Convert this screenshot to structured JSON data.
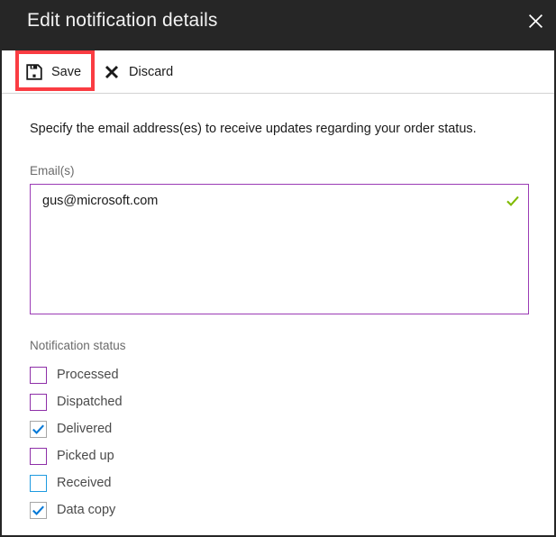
{
  "window": {
    "title": "Edit notification details",
    "close_icon": "close-icon"
  },
  "commandbar": {
    "save": {
      "label": "Save",
      "icon": "save-floppy-icon"
    },
    "discard": {
      "label": "Discard",
      "icon": "cross-icon"
    },
    "highlight_color": "#fa3c42"
  },
  "form": {
    "instructions": "Specify the email address(es) to receive updates regarding your order status.",
    "email": {
      "label": "Email(s)",
      "value": "gus@microsoft.com",
      "placeholder": "",
      "valid_icon": "check-mark-icon",
      "valid_icon_color": "#7fba00",
      "border_color": "#9b3bb5"
    },
    "notification_status": {
      "label": "Notification status",
      "items": [
        {
          "label": "Processed",
          "checked": false,
          "border": "purple"
        },
        {
          "label": "Dispatched",
          "checked": false,
          "border": "purple"
        },
        {
          "label": "Delivered",
          "checked": true,
          "border": "gray"
        },
        {
          "label": "Picked up",
          "checked": false,
          "border": "purple"
        },
        {
          "label": "Received",
          "checked": false,
          "border": "blue"
        },
        {
          "label": "Data copy",
          "checked": true,
          "border": "gray"
        }
      ],
      "check_color": "#0078d7"
    }
  }
}
